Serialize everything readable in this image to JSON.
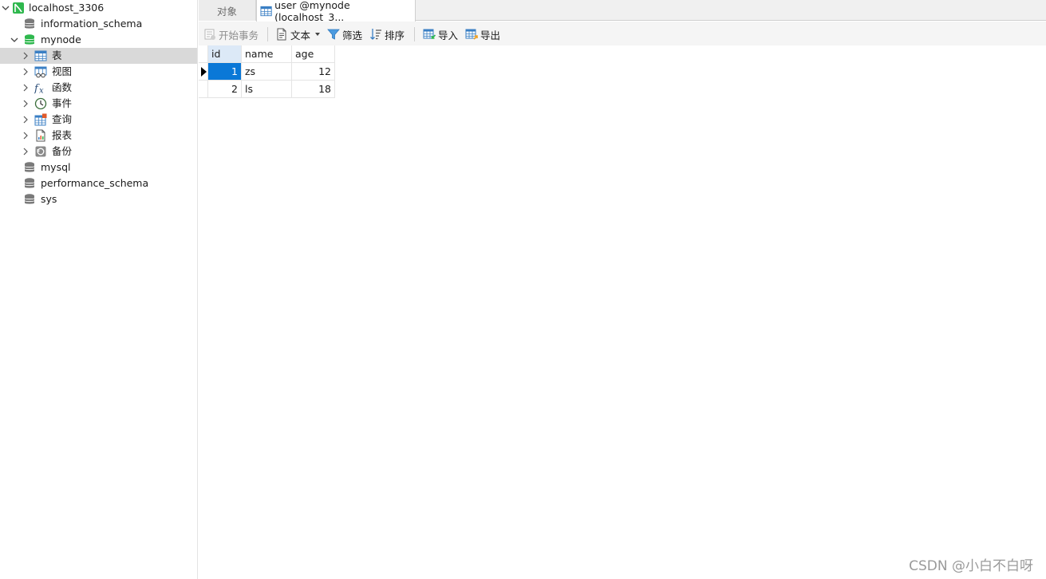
{
  "sidebar": {
    "connection": {
      "label": "localhost_3306",
      "icon": "connection-icon",
      "color": "#2fb84e"
    },
    "databases": [
      {
        "label": "information_schema",
        "icon": "database-icon"
      },
      {
        "label": "mynode",
        "icon": "database-icon",
        "color": "#2fb84e"
      },
      {
        "label": "mysql",
        "icon": "database-icon"
      },
      {
        "label": "performance_schema",
        "icon": "database-icon"
      },
      {
        "label": "sys",
        "icon": "database-icon"
      }
    ],
    "mynode_children": [
      {
        "label": "表",
        "icon": "table-icon"
      },
      {
        "label": "视图",
        "icon": "view-icon"
      },
      {
        "label": "函数",
        "icon": "function-icon"
      },
      {
        "label": "事件",
        "icon": "event-icon"
      },
      {
        "label": "查询",
        "icon": "query-icon"
      },
      {
        "label": "报表",
        "icon": "report-icon"
      },
      {
        "label": "备份",
        "icon": "backup-icon"
      }
    ]
  },
  "tabs": [
    {
      "label": "对象",
      "active": false
    },
    {
      "label": "user @mynode (localhost_3...",
      "active": true,
      "icon": "table-icon"
    }
  ],
  "toolbar": {
    "begin_transaction": "开始事务",
    "text": "文本",
    "filter": "筛选",
    "sort": "排序",
    "import": "导入",
    "export": "导出"
  },
  "grid": {
    "columns": [
      "id",
      "name",
      "age"
    ],
    "rows": [
      {
        "id": "1",
        "name": "zs",
        "age": "12"
      },
      {
        "id": "2",
        "name": "ls",
        "age": "18"
      }
    ],
    "selection_color": "#0a78d7"
  },
  "watermark": "CSDN @小白不白呀"
}
